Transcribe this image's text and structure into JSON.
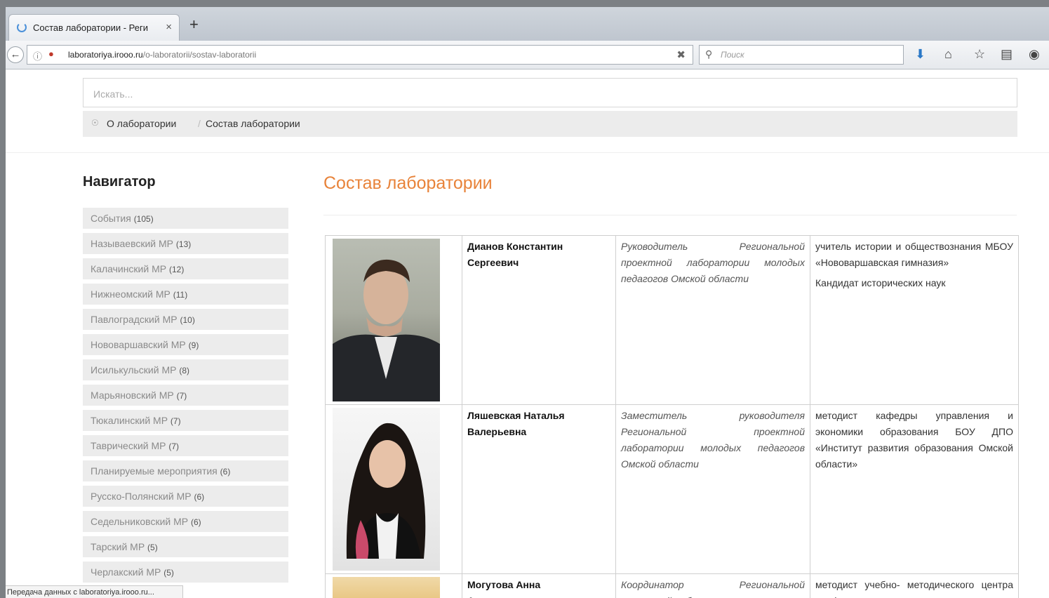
{
  "browser": {
    "tab_title": "Состав лаборатории - Реги",
    "tab_close": "×",
    "new_tab": "+",
    "url_host": "laboratoriya.irooo.ru",
    "url_path": "/o-laboratorii/sostav-laboratorii",
    "search_placeholder": "Поиск",
    "status": "Передача данных с laboratoriya.irooo.ru..."
  },
  "site": {
    "search_placeholder": "Искать...",
    "breadcrumb": [
      "О лаборатории",
      "Состав лаборатории"
    ],
    "breadcrumb_sep": "/"
  },
  "sidebar": {
    "title": "Навигатор",
    "items": [
      {
        "label": "События",
        "count": "(105)"
      },
      {
        "label": "Называевский МР",
        "count": "(13)"
      },
      {
        "label": "Калачинский МР",
        "count": "(12)"
      },
      {
        "label": "Нижнеомский МР",
        "count": "(11)"
      },
      {
        "label": "Павлоградский МР",
        "count": "(10)"
      },
      {
        "label": "Нововаршавский МР",
        "count": "(9)"
      },
      {
        "label": "Исилькульский МР",
        "count": "(8)"
      },
      {
        "label": "Марьяновский МР",
        "count": "(7)"
      },
      {
        "label": "Тюкалинский МР",
        "count": "(7)"
      },
      {
        "label": "Таврический МР",
        "count": "(7)"
      },
      {
        "label": "Планируемые мероприятия",
        "count": "(6)"
      },
      {
        "label": "Русско-Полянский МР",
        "count": "(6)"
      },
      {
        "label": "Седельниковский МР",
        "count": "(6)"
      },
      {
        "label": "Тарский МР",
        "count": "(5)"
      },
      {
        "label": "Черлакский МР",
        "count": "(5)"
      }
    ]
  },
  "main": {
    "title": "Состав лаборатории",
    "members": [
      {
        "name": "Дианов Константин Сергеевич",
        "role": "Руководитель Региональной проектной лаборатории молодых педагогов Омской области",
        "position": "учитель истории и обществознания МБОУ «Нововаршавская гимназия»",
        "degree": "Кандидат исторических наук"
      },
      {
        "name": "Ляшевская Наталья Валерьевна",
        "role": "Заместитель руководителя Региональной проектной лаборатории молодых педагогов Омской области",
        "position": "методист кафедры управления и экономики образования БОУ ДПО «Институт развития образования Омской области»",
        "degree": ""
      },
      {
        "name": "Могутова Анна Александровна",
        "role": "Координатор Региональной проектной лаборатории",
        "position": "методист учебно- методического центра профессионального",
        "degree": ""
      }
    ]
  },
  "colors": {
    "accent": "#e8833a",
    "nav_bg": "#ececec"
  },
  "icons": [
    "loading-spinner-icon",
    "back-arrow-icon",
    "info-icon",
    "lock-icon",
    "stop-icon",
    "search-icon",
    "download-icon",
    "home-icon",
    "bookmark-star-icon",
    "library-icon",
    "pocket-icon",
    "map-pin-icon"
  ]
}
